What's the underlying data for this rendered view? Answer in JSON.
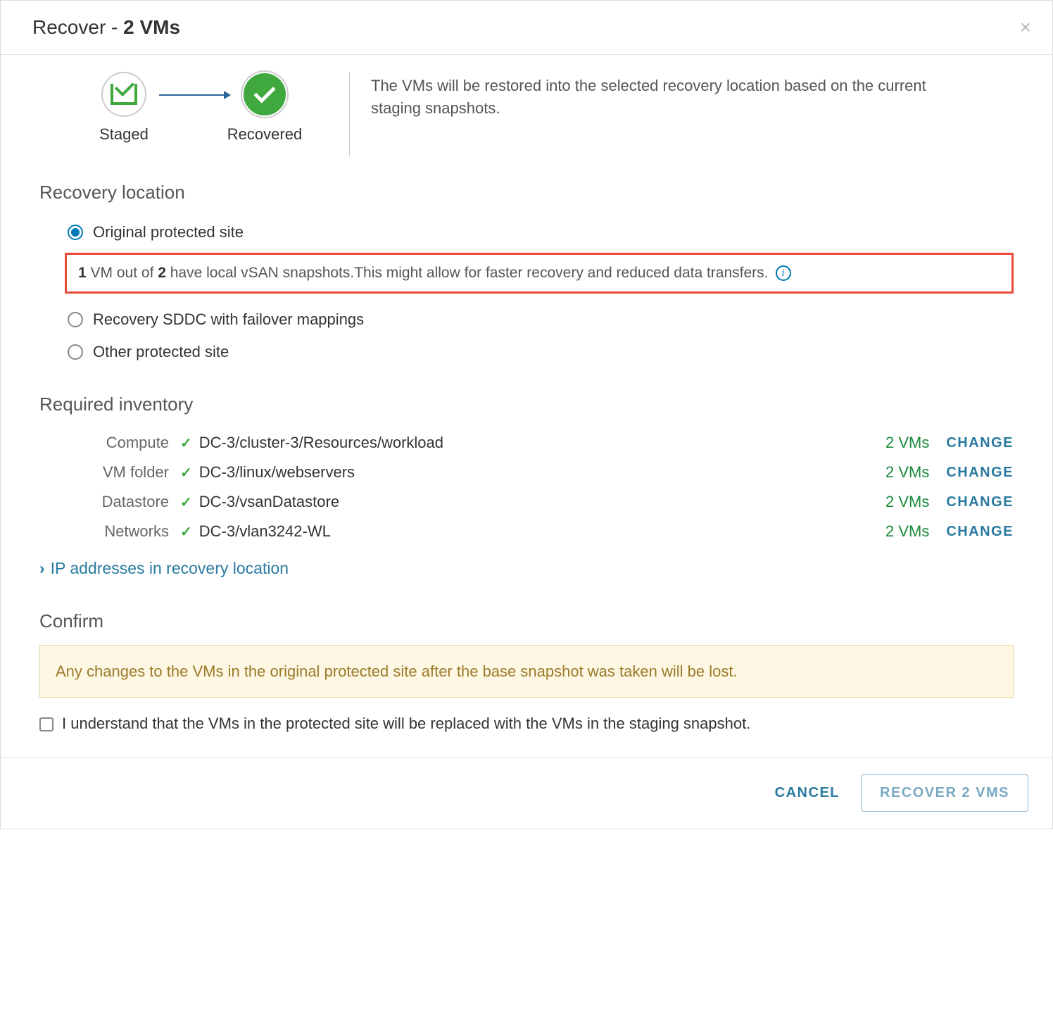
{
  "dialog": {
    "title_prefix": "Recover - ",
    "title_bold": "2 VMs"
  },
  "stepper": {
    "staged_label": "Staged",
    "recovered_label": "Recovered",
    "description": "The VMs will be restored into the selected recovery location based on the current staging snapshots."
  },
  "recovery_location": {
    "heading": "Recovery location",
    "option_original": "Original protected site",
    "highlight": {
      "n1": "1",
      "mid1": " VM out of ",
      "n2": "2",
      "rest": " have local vSAN snapshots.This might allow for faster recovery and reduced data transfers."
    },
    "option_sddc": "Recovery SDDC with failover mappings",
    "option_other": "Other protected site"
  },
  "inventory": {
    "heading": "Required inventory",
    "rows": [
      {
        "label": "Compute",
        "value": "DC-3/cluster-3/Resources/workload",
        "count": "2 VMs",
        "change": "CHANGE"
      },
      {
        "label": "VM folder",
        "value": "DC-3/linux/webservers",
        "count": "2 VMs",
        "change": "CHANGE"
      },
      {
        "label": "Datastore",
        "value": "DC-3/vsanDatastore",
        "count": "2 VMs",
        "change": "CHANGE"
      },
      {
        "label": "Networks",
        "value": "DC-3/vlan3242-WL",
        "count": "2 VMs",
        "change": "CHANGE"
      }
    ],
    "ip_expand": "IP addresses in recovery location"
  },
  "confirm": {
    "heading": "Confirm",
    "warning": "Any changes to the VMs in the original protected site after the base snapshot was taken will be lost.",
    "checkbox_label": "I understand that the VMs in the protected site will be replaced with the VMs in the staging snapshot."
  },
  "footer": {
    "cancel": "CANCEL",
    "primary": "RECOVER 2 VMS"
  }
}
